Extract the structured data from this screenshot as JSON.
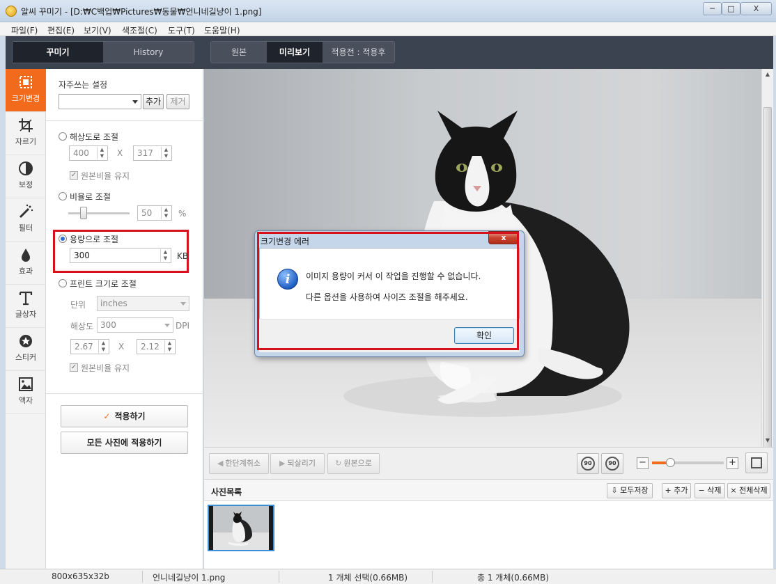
{
  "window": {
    "title": "알씨 꾸미기 - [D:₩C백업₩Pictures₩동물₩언니네길냥이 1.png]",
    "minimize": "─",
    "maximize": "□",
    "close": "X"
  },
  "menu": [
    "파일(F)",
    "편집(E)",
    "보기(V)",
    "색조절(C)",
    "도구(T)",
    "도움말(H)"
  ],
  "left_tabs": {
    "decorate": "꾸미기",
    "history": "History"
  },
  "view_tabs": {
    "original": "원본",
    "preview": "미리보기",
    "before_after": "적용전 : 적용후"
  },
  "tools": [
    {
      "label": "크기변경",
      "icon": "resize-icon",
      "active": true
    },
    {
      "label": "자르기",
      "icon": "crop-icon",
      "active": false
    },
    {
      "label": "보정",
      "icon": "adjust-icon",
      "active": false
    },
    {
      "label": "필터",
      "icon": "filter-wand-icon",
      "active": false
    },
    {
      "label": "효과",
      "icon": "drop-icon",
      "active": false
    },
    {
      "label": "글상자",
      "icon": "text-icon",
      "active": false
    },
    {
      "label": "스티커",
      "icon": "sticker-star-icon",
      "active": false
    },
    {
      "label": "액자",
      "icon": "frame-picture-icon",
      "active": false
    }
  ],
  "panel": {
    "favorites_label": "자주쓰는 설정",
    "favorites_value": "",
    "add_button": "추가",
    "remove_button": "제거",
    "resolution": {
      "label": "해상도로 조절",
      "width": "400",
      "x": "X",
      "height": "317",
      "keep_ratio": "원본비율 유지"
    },
    "ratio": {
      "label": "비율로 조절",
      "value": "50",
      "unit": "%",
      "slider_fraction": 0.25
    },
    "filesize": {
      "label": "용량으로 조절",
      "value": "300",
      "unit": "KB",
      "selected": true
    },
    "print": {
      "label": "프린트 크기로 조절",
      "unit_label": "단위",
      "unit_value": "inches",
      "res_label": "해상도",
      "res_value": "300",
      "res_unit": "DPI",
      "width": "2.67",
      "x": "X",
      "height": "2.12",
      "keep_ratio": "원본비율 유지"
    },
    "apply_button": "적용하기",
    "apply_all_button": "모든 사진에 적용하기"
  },
  "dialog": {
    "title": "크기변경 에러",
    "close": "x",
    "line1": "이미지 용량이 커서 이 작업을 진행할 수 없습니다.",
    "line2": "다른 옵션을 사용하여 사이즈 조절을 해주세요.",
    "ok_button": "확인"
  },
  "toolbar": {
    "undo": "한단계취소",
    "redo": "되살리기",
    "revert": "원본으로",
    "rotate_left": "90",
    "rotate_right": "90",
    "zoom_minus": "−",
    "zoom_plus": "+",
    "zoom_fraction": 0.25
  },
  "photolist": {
    "title": "사진목록",
    "save_all": "모두저장",
    "add": "+ 추가",
    "remove": "− 삭제",
    "remove_all": "× 전체삭제"
  },
  "status": {
    "dims": "800x635x32b",
    "filename": "언니네길냥이 1.png",
    "selected": "1 개체 선택(0.66MB)",
    "total": "총 1 개체(0.66MB)"
  }
}
